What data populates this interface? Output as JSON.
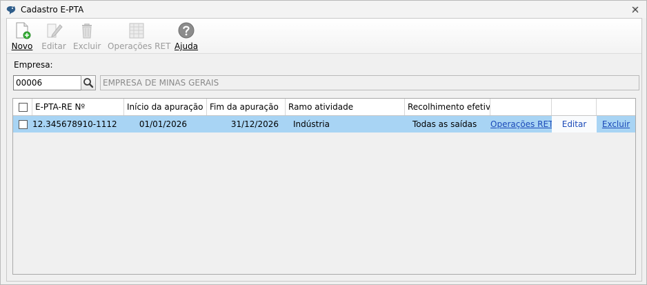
{
  "window": {
    "title": "Cadastro E-PTA"
  },
  "toolbar": {
    "buttons": [
      {
        "label": "Novo",
        "enabled": true
      },
      {
        "label": "Editar",
        "enabled": false
      },
      {
        "label": "Excluir",
        "enabled": false
      },
      {
        "label": "Operações RET",
        "enabled": false
      },
      {
        "label": "Ajuda",
        "enabled": true
      }
    ]
  },
  "empresa": {
    "label": "Empresa:",
    "code": "00006",
    "name": "EMPRESA DE MINAS GERAIS"
  },
  "table": {
    "columns": [
      "E-PTA-RE Nº",
      "Início da apuração",
      "Fim da apuração",
      "Ramo atividade",
      "Recolhimento efetivo"
    ],
    "rows": [
      {
        "checked": false,
        "selected": true,
        "epta": "12.345678910-1112",
        "inicio": "01/01/2026",
        "fim": "31/12/2026",
        "ramo": "Indústria",
        "recolhimento": "Todas as saídas",
        "op_ret": "Operações RET",
        "editar": "Editar",
        "excluir": "Excluir"
      }
    ]
  }
}
